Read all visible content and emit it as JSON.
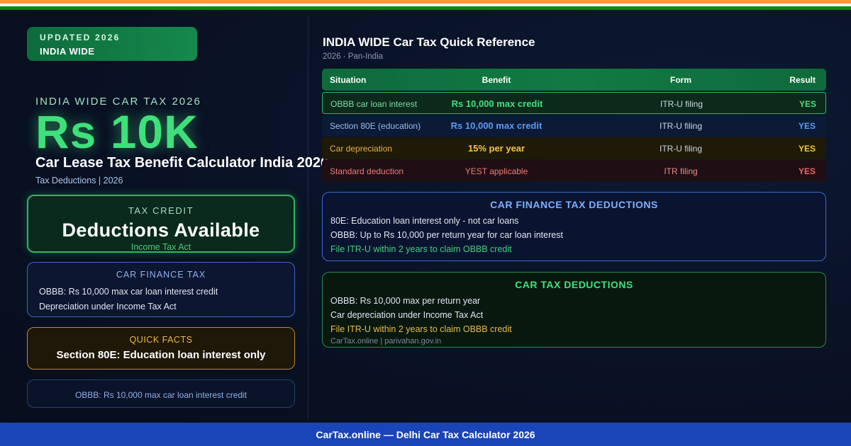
{
  "colors": {
    "saffron": "#ff9933",
    "white": "#ffffff",
    "india_green": "#138808",
    "accent_green": "#3ee07a",
    "accent_blue": "#5c9bf5",
    "accent_amber": "#f3c24a",
    "accent_red": "#f06565",
    "footer_blue": "#1a45b8"
  },
  "badge": {
    "line1": "UPDATED 2026",
    "line2": "INDIA WIDE"
  },
  "hero": {
    "kicker": "INDIA WIDE CAR TAX 2026",
    "amount": "Rs 10K",
    "title": "Car Lease Tax Benefit Calculator India 2026",
    "subtitle": "Tax Deductions | 2026"
  },
  "cards": {
    "tax_credit": {
      "label": "TAX CREDIT",
      "value": "Deductions Available",
      "sub": "Income Tax Act"
    },
    "car_finance_tax": {
      "label": "CAR FINANCE TAX",
      "lines": [
        "OBBB: Rs 10,000 max car loan interest credit",
        "Depreciation under Income Tax Act"
      ]
    },
    "quick_facts": {
      "label": "QUICK FACTS",
      "value": "Section 80E: Education loan interest only"
    },
    "note": {
      "text": "OBBB: Rs 10,000 max car loan interest credit"
    }
  },
  "reference": {
    "title": "INDIA WIDE Car Tax Quick Reference",
    "subtitle": "2026 · Pan-India",
    "headers": [
      "Situation",
      "Benefit",
      "Form",
      "Result"
    ],
    "rows": [
      [
        "OBBB car loan interest",
        "Rs 10,000 max credit",
        "ITR-U filing",
        "YES"
      ],
      [
        "Section 80E (education)",
        "Rs 10,000 max credit",
        "ITR-U filing",
        "YES"
      ],
      [
        "Car depreciation",
        "15% per year",
        "ITR-U filing",
        "YES"
      ],
      [
        "Standard deduction",
        "YEST applicable",
        "ITR filing",
        "YES"
      ]
    ]
  },
  "panels": {
    "finance": {
      "title": "CAR FINANCE TAX DEDUCTIONS",
      "lines": [
        "80E: Education loan interest only - not car loans",
        "OBBB: Up to Rs 10,000 per return year for car loan interest",
        "File ITR-U within 2 years to claim OBBB credit"
      ]
    },
    "deductions": {
      "title": "CAR TAX DEDUCTIONS",
      "lines": [
        "OBBB: Rs 10,000 max per return year",
        "Car depreciation under Income Tax Act",
        "File ITR-U within 2 years to claim OBBB credit"
      ],
      "source": "CarTax.online | parivahan.gov.in"
    }
  },
  "footer": {
    "text": "CarTax.online — Delhi Car Tax Calculator 2026"
  }
}
